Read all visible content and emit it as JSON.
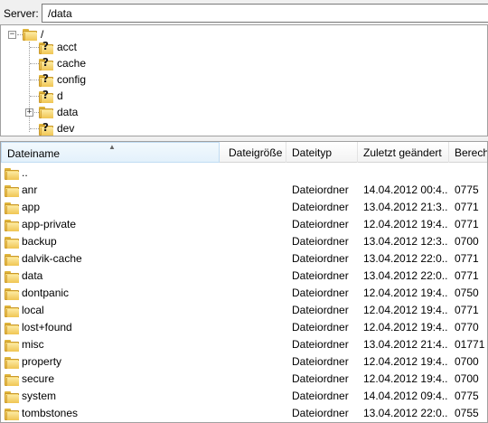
{
  "server": {
    "label": "Server:",
    "path": "/data"
  },
  "tree": {
    "root": "/",
    "children": [
      {
        "label": "acct",
        "icon": "unknown-folder-icon"
      },
      {
        "label": "cache",
        "icon": "unknown-folder-icon"
      },
      {
        "label": "config",
        "icon": "unknown-folder-icon"
      },
      {
        "label": "d",
        "icon": "unknown-folder-icon"
      },
      {
        "label": "data",
        "icon": "folder-icon"
      },
      {
        "label": "dev",
        "icon": "unknown-folder-icon"
      }
    ]
  },
  "list": {
    "columns": [
      "Dateiname",
      "Dateigröße",
      "Dateityp",
      "Zuletzt geändert",
      "Berecht"
    ],
    "rows": [
      {
        "name": "..",
        "size": "",
        "type": "",
        "modified": "",
        "perms": ""
      },
      {
        "name": "anr",
        "size": "",
        "type": "Dateiordner",
        "modified": "14.04.2012 00:4...",
        "perms": "0775"
      },
      {
        "name": "app",
        "size": "",
        "type": "Dateiordner",
        "modified": "13.04.2012 21:3...",
        "perms": "0771"
      },
      {
        "name": "app-private",
        "size": "",
        "type": "Dateiordner",
        "modified": "12.04.2012 19:4...",
        "perms": "0771"
      },
      {
        "name": "backup",
        "size": "",
        "type": "Dateiordner",
        "modified": "13.04.2012 12:3...",
        "perms": "0700"
      },
      {
        "name": "dalvik-cache",
        "size": "",
        "type": "Dateiordner",
        "modified": "13.04.2012 22:0...",
        "perms": "0771"
      },
      {
        "name": "data",
        "size": "",
        "type": "Dateiordner",
        "modified": "13.04.2012 22:0...",
        "perms": "0771"
      },
      {
        "name": "dontpanic",
        "size": "",
        "type": "Dateiordner",
        "modified": "12.04.2012 19:4...",
        "perms": "0750"
      },
      {
        "name": "local",
        "size": "",
        "type": "Dateiordner",
        "modified": "12.04.2012 19:4...",
        "perms": "0771"
      },
      {
        "name": "lost+found",
        "size": "",
        "type": "Dateiordner",
        "modified": "12.04.2012 19:4...",
        "perms": "0770"
      },
      {
        "name": "misc",
        "size": "",
        "type": "Dateiordner",
        "modified": "13.04.2012 21:4...",
        "perms": "01771"
      },
      {
        "name": "property",
        "size": "",
        "type": "Dateiordner",
        "modified": "12.04.2012 19:4...",
        "perms": "0700"
      },
      {
        "name": "secure",
        "size": "",
        "type": "Dateiordner",
        "modified": "12.04.2012 19:4...",
        "perms": "0700"
      },
      {
        "name": "system",
        "size": "",
        "type": "Dateiordner",
        "modified": "14.04.2012 09:4...",
        "perms": "0775"
      },
      {
        "name": "tombstones",
        "size": "",
        "type": "Dateiordner",
        "modified": "13.04.2012 22:0...",
        "perms": "0755"
      }
    ]
  },
  "colors": {
    "folder": "#f0c552",
    "sorted_header": "#e3f1fb",
    "border": "#a0a0a0"
  }
}
